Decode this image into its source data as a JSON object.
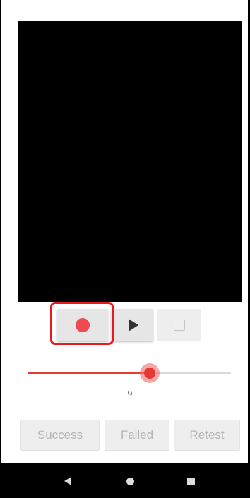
{
  "recorder": {
    "controls": {
      "record_icon": "record-icon",
      "play_icon": "play-icon",
      "stop_icon": "stop-icon"
    },
    "slider": {
      "value_label": "9",
      "fill_fraction": 0.6
    }
  },
  "actions": {
    "success_label": "Success",
    "failed_label": "Failed",
    "retest_label": "Retest"
  },
  "navigation": {
    "back_icon": "back-icon",
    "home_icon": "home-icon",
    "recents_icon": "recents-icon"
  },
  "colors": {
    "accent": "#e53935",
    "record": "#ee4a52",
    "highlight": "#e8191f"
  }
}
